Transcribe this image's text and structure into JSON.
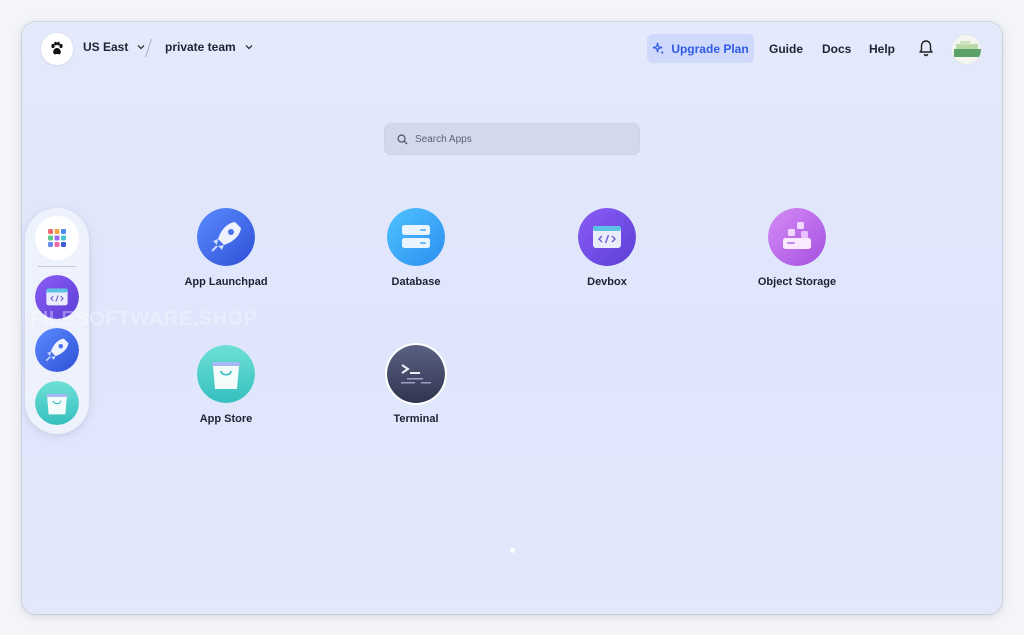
{
  "topbar": {
    "region": "US East",
    "team": "private team",
    "upgrade_label": "Upgrade Plan",
    "guide": "Guide",
    "docs": "Docs",
    "help": "Help"
  },
  "search": {
    "placeholder": "Search Apps"
  },
  "apps": [
    {
      "label": "App Launchpad",
      "icon": "rocket-icon"
    },
    {
      "label": "Database",
      "icon": "database-icon"
    },
    {
      "label": "Devbox",
      "icon": "devbox-code-icon"
    },
    {
      "label": "Object Storage",
      "icon": "object-storage-icon"
    },
    {
      "label": "App Store",
      "icon": "shopping-bag-icon"
    },
    {
      "label": "Terminal",
      "icon": "terminal-icon"
    }
  ],
  "dock": [
    "grid-apps-icon",
    "devbox-code-icon",
    "rocket-icon",
    "shopping-bag-icon"
  ],
  "watermark": "FILESOFTWARE.SHOP",
  "colors": {
    "accent": "#2d5be3",
    "upgrade_bg": "#cfd9fb",
    "background": "#e2e7fb"
  }
}
